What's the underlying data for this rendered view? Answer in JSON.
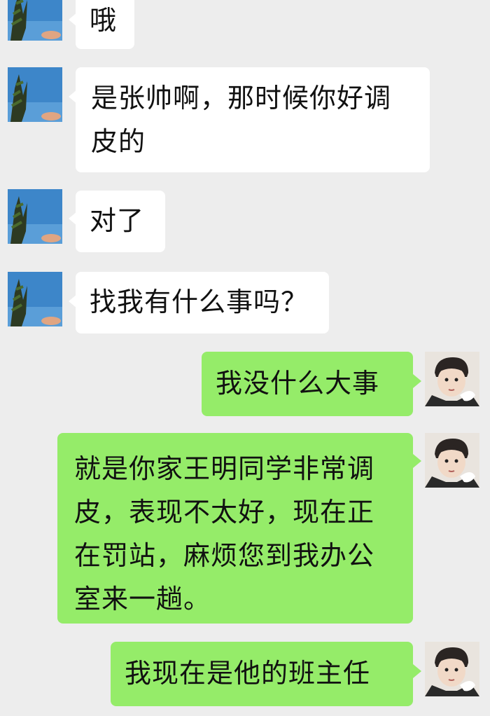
{
  "colors": {
    "background": "#ededed",
    "incoming_bubble": "#ffffff",
    "outgoing_bubble": "#95ec69"
  },
  "messages": [
    {
      "side": "in",
      "avatar": "sky-tree-avatar",
      "text": "哦"
    },
    {
      "side": "in",
      "avatar": "sky-tree-avatar",
      "text": "是张帅啊，那时候你好调皮的"
    },
    {
      "side": "in",
      "avatar": "sky-tree-avatar",
      "text": "对了"
    },
    {
      "side": "in",
      "avatar": "sky-tree-avatar",
      "text": "找我有什么事吗？"
    },
    {
      "side": "out",
      "avatar": "person-avatar",
      "text": "我没什么大事"
    },
    {
      "side": "out",
      "avatar": "person-avatar",
      "text": "就是你家王明同学非常调皮，表现不太好，现在正在罚站，麻烦您到我办公室来一趟。"
    },
    {
      "side": "out",
      "avatar": "person-avatar",
      "text": "我现在是他的班主任"
    }
  ]
}
